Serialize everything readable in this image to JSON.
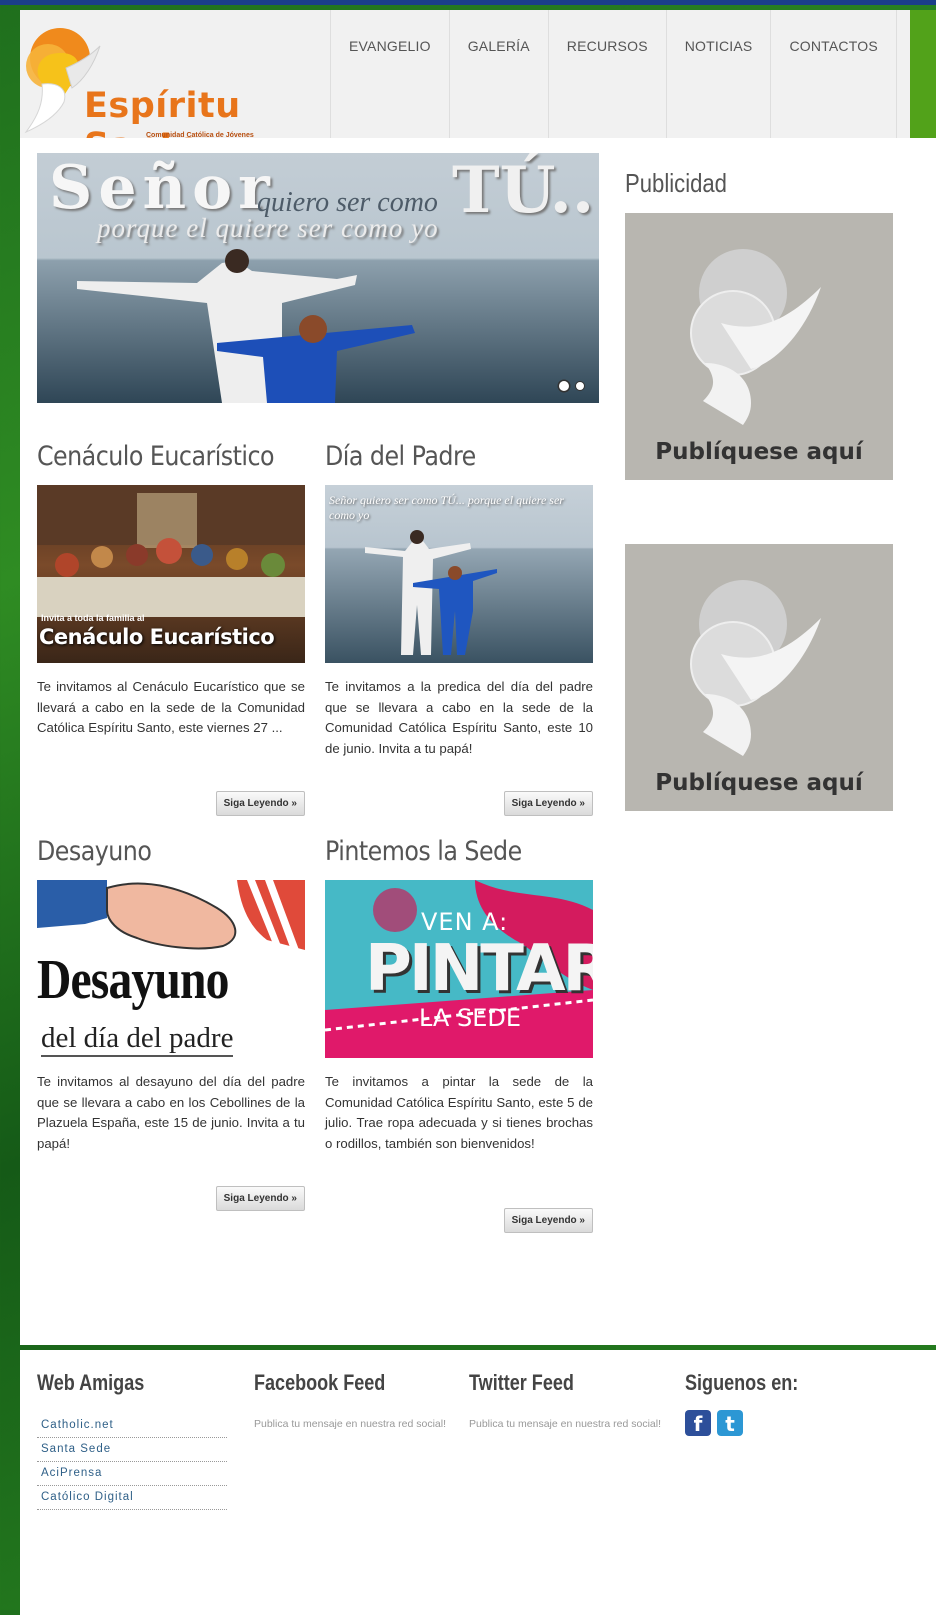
{
  "header": {
    "logo_text": "Espíritu Santo",
    "logo_subtitle": "Comunidad Católica de Jóvenes",
    "nav": [
      "EVANGELIO",
      "GALERÍA",
      "RECURSOS",
      "NOTICIAS",
      "CONTACTOS"
    ]
  },
  "slider": {
    "line1": "Señor",
    "line2": "quiero ser como",
    "line3": "TÚ...",
    "line4": "porque el quiere ser como yo",
    "slide_count": 2,
    "active_slide": 1
  },
  "posts": [
    {
      "title": "Cenáculo Eucarístico",
      "image_caption_small": "Invita a toda la familia al",
      "image_caption": "Cenáculo Eucarístico",
      "text": "Te invitamos al Cenáculo Eucarístico que se llevará a cabo en la sede de la Comunidad Católica Espíritu Santo, este viernes 27 ...",
      "button": "Siga Leyendo »"
    },
    {
      "title": "Día del Padre",
      "image_caption_small": "",
      "image_caption": "Señor quiero ser como TÚ... porque el quiere ser como yo",
      "text": "Te invitamos a la predica del día del padre que se llevara a cabo en la sede de la Comunidad Católica Espíritu Santo, este 10 de junio. Invita a tu papá!",
      "button": "Siga Leyendo »"
    },
    {
      "title": "Desayuno",
      "image_caption_small": "del día del padre",
      "image_caption": "Desayuno",
      "text": "Te invitamos al desayuno del día del padre que se llevara a cabo en los Cebollines de la Plazuela España, este 15 de junio. Invita a tu papá!",
      "button": "Siga Leyendo »"
    },
    {
      "title": "Pintemos la Sede",
      "image_caption_small": "LA SEDE",
      "image_caption": "PINTAR",
      "image_caption_top": "VEN A:",
      "text": "Te invitamos a pintar la sede de la Comunidad Católica Espíritu Santo, este 5 de julio. Trae ropa adecuada y si tienes brochas o rodillos, también son bienvenidos!",
      "button": "Siga Leyendo »"
    }
  ],
  "sidebar": {
    "title": "Publicidad",
    "ads": [
      "Publíquese aquí",
      "Publíquese aquí"
    ]
  },
  "footer": {
    "web_amigas": {
      "title": "Web Amigas",
      "links": [
        "Catholic.net",
        "Santa Sede",
        "AciPrensa",
        "Católico Digital"
      ]
    },
    "facebook": {
      "title": "Facebook Feed",
      "text": "Publica tu mensaje en nuestra red social!"
    },
    "twitter": {
      "title": "Twitter Feed",
      "text": "Publica tu mensaje en nuestra red social!"
    },
    "social": {
      "title": "Siguenos en:",
      "icons": [
        "facebook-icon",
        "twitter-icon"
      ],
      "colors": {
        "facebook": "#2d4f9a",
        "twitter": "#2c97d4"
      }
    }
  }
}
